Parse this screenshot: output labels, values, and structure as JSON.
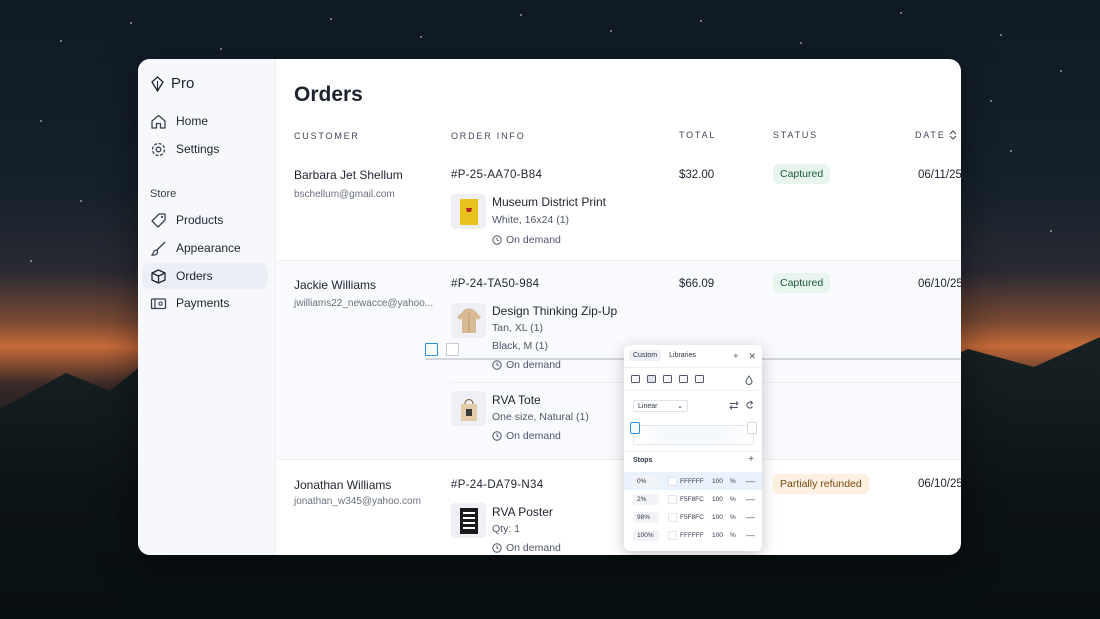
{
  "app": {
    "name": "Pro"
  },
  "nav": {
    "top": [
      {
        "label": "Home",
        "icon": "home-icon"
      },
      {
        "label": "Settings",
        "icon": "gear-icon"
      }
    ],
    "section_label": "Store",
    "store": [
      {
        "label": "Products",
        "icon": "tag-icon"
      },
      {
        "label": "Appearance",
        "icon": "brush-icon"
      },
      {
        "label": "Orders",
        "icon": "box-icon",
        "active": true
      },
      {
        "label": "Payments",
        "icon": "payments-icon"
      }
    ]
  },
  "page": {
    "title": "Orders"
  },
  "table": {
    "headers": {
      "customer": "CUSTOMER",
      "order_info": "ORDER INFO",
      "total": "TOTAL",
      "status": "STATUS",
      "date": "DATE"
    },
    "rows": [
      {
        "customer": "Barbara Jet Shellum",
        "email": "bschellum@gmail.com",
        "order_id": "#P-25-AA70-B84",
        "total": "$32.00",
        "status": "Captured",
        "date": "06/11/25",
        "items": [
          {
            "name": "Museum District Print",
            "variant": "White, 16x24 (1)",
            "fulfillment": "On demand"
          }
        ]
      },
      {
        "customer": "Jackie Williams",
        "email": "jwilliams22_newacce@yahoo...",
        "order_id": "#P-24-TA50-984",
        "total": "$66.09",
        "status": "Captured",
        "date": "06/10/25",
        "items": [
          {
            "name": "Design Thinking Zip-Up",
            "variant": "Tan, XL (1)",
            "variant2": "Black, M (1)",
            "fulfillment": "On demand"
          },
          {
            "name": "RVA Tote",
            "variant": "One size, Natural (1)",
            "fulfillment": "On demand"
          }
        ]
      },
      {
        "customer": "Jonathan Williams",
        "email": "jonathan_w345@yahoo.com",
        "order_id": "#P-24-DA79-N34",
        "status": "Partially refunded",
        "date": "06/10/25",
        "items": [
          {
            "name": "RVA Poster",
            "variant": "Qty: 1",
            "fulfillment": "On demand"
          }
        ]
      }
    ]
  },
  "picker": {
    "tabs": [
      "Custom",
      "Libraries"
    ],
    "mode": "Linear",
    "stops_title": "Stops",
    "stops": [
      {
        "position": "0%",
        "hex": "FFFFFF",
        "opacity": "100",
        "unit": "%"
      },
      {
        "position": "2%",
        "hex": "F5F8FC",
        "opacity": "100",
        "unit": "%"
      },
      {
        "position": "98%",
        "hex": "F5F8FC",
        "opacity": "100",
        "unit": "%"
      },
      {
        "position": "100%",
        "hex": "FFFFFF",
        "opacity": "100",
        "unit": "%"
      }
    ]
  },
  "colors": {
    "captured_bg": "#e7f5ee",
    "partial_bg": "#fdf0e0",
    "selection": "#2a8fd8"
  }
}
